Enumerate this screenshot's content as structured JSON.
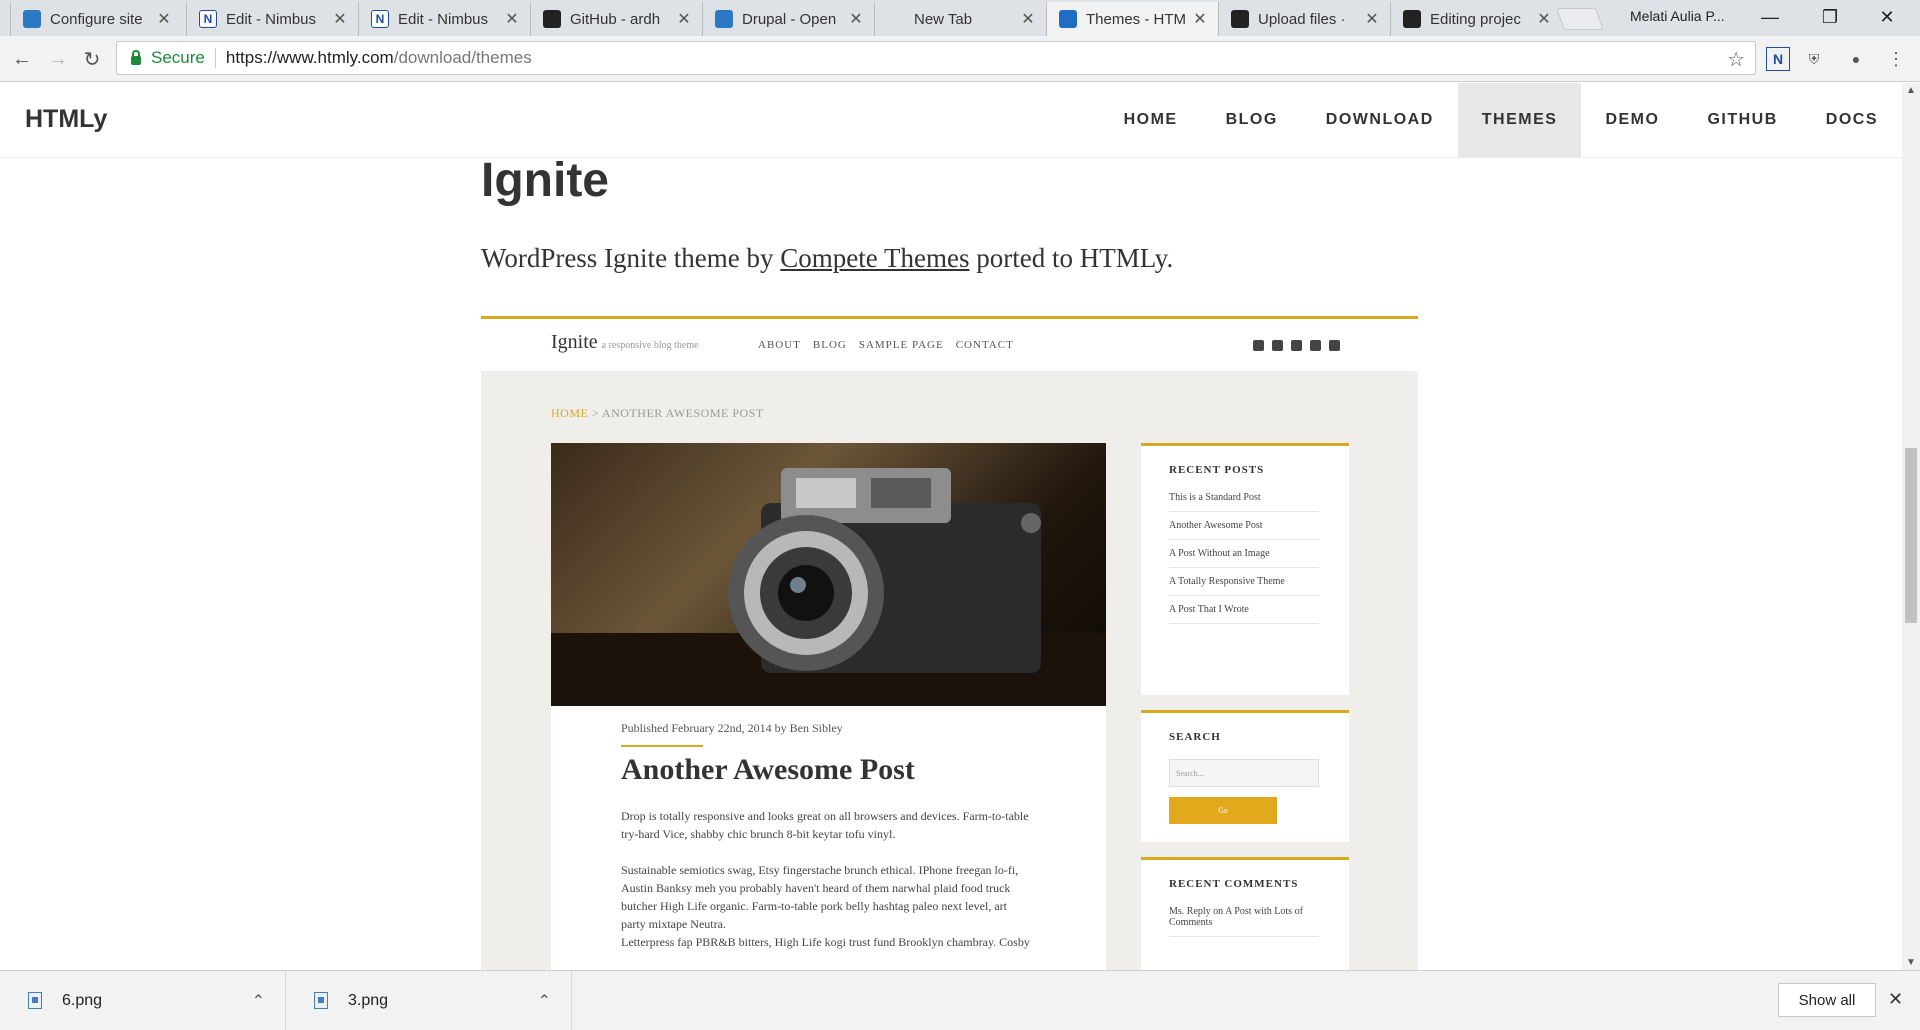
{
  "browser": {
    "tabs": [
      {
        "title": "Configure site",
        "icon": "drupal-icon"
      },
      {
        "title": "Edit - Nimbus",
        "icon": "nimbus-icon"
      },
      {
        "title": "Edit - Nimbus",
        "icon": "nimbus-icon"
      },
      {
        "title": "GitHub - ardh",
        "icon": "github-icon"
      },
      {
        "title": "Drupal - Open",
        "icon": "drupal-icon"
      },
      {
        "title": "New Tab",
        "icon": ""
      },
      {
        "title": "Themes - HTM",
        "icon": "htmly-icon"
      },
      {
        "title": "Upload files ·",
        "icon": "github-icon"
      },
      {
        "title": "Editing projec",
        "icon": "github-icon"
      }
    ],
    "profile_name": "Melati Aulia P...",
    "security_label": "Secure",
    "url_host": "https://www.htmly.com",
    "url_path": "/download/themes"
  },
  "site": {
    "brand": "HTMLy",
    "nav": [
      "HOME",
      "BLOG",
      "DOWNLOAD",
      "THEMES",
      "DEMO",
      "GITHUB",
      "DOCS"
    ],
    "active_nav": "THEMES"
  },
  "theme": {
    "title": "Ignite",
    "desc_prefix": "WordPress Ignite theme by ",
    "desc_link": "Compete Themes",
    "desc_suffix": " ported to HTMLy."
  },
  "preview": {
    "logo": "Ignite",
    "tagline": "a responsive blog theme",
    "menu": [
      "ABOUT",
      "BLOG",
      "SAMPLE PAGE",
      "CONTACT"
    ],
    "breadcrumb_home": "HOME",
    "breadcrumb_rest": " > ANOTHER AWESOME POST",
    "post_meta": "Published February 22nd, 2014 by Ben Sibley",
    "post_title": "Another Awesome Post",
    "paragraphs": [
      "Drop is totally responsive and looks great on all browsers and devices. Farm-to-table try-hard Vice, shabby chic brunch 8-bit keytar tofu vinyl.",
      "Sustainable semiotics swag, Etsy fingerstache brunch ethical. IPhone freegan lo-fi, Austin Banksy meh you probably haven't heard of them narwhal plaid food truck butcher High Life organic. Farm-to-table pork belly hashtag paleo next level, art party mixtape Neutra.",
      "Letterpress fap PBR&B bitters, High Life kogi trust fund Brooklyn chambray. Cosby"
    ],
    "recent_posts_title": "RECENT POSTS",
    "recent_posts": [
      "This is a Standard Post",
      "Another Awesome Post",
      "A Post Without an Image",
      "A Totally Responsive Theme",
      "A Post That I Wrote"
    ],
    "search_title": "SEARCH",
    "search_placeholder": "Search...",
    "search_button": "Go",
    "recent_comments_title": "RECENT COMMENTS",
    "recent_comments": [
      "Ms. Reply on A Post with Lots of Comments"
    ]
  },
  "downloads": {
    "items": [
      "6.png",
      "3.png"
    ],
    "show_all": "Show all"
  },
  "colors": {
    "accent": "#d8a91c",
    "secure_green": "#1b8a3a"
  }
}
